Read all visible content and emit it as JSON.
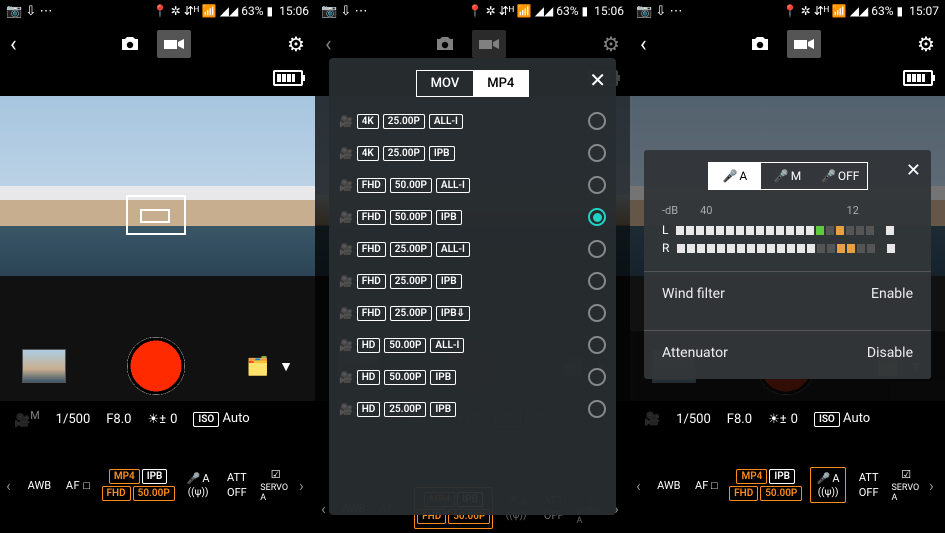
{
  "statusbar": {
    "left_icons": "📷  ⇩  ⋯",
    "right_icons": "📍 ✲ ⇵ᴴ 📶 ◢◢ 63% ▮",
    "time_a": "15:06",
    "time_b": "15:06",
    "time_c": "15:07",
    "battery_pct": "63%"
  },
  "info": {
    "camera_mode_label": "M",
    "shutter": "1/500",
    "aperture": "F8.0",
    "ev": "0",
    "iso_label": "ISO",
    "iso_value": "Auto"
  },
  "strip": {
    "awb": "AWB",
    "af": "AF □",
    "mp4": "MP4",
    "ipb": "IPB",
    "fhd": "FHD",
    "fps": "50.00P",
    "mic_mode": "A",
    "wind": "((ψ))",
    "att": "ATT",
    "att_state": "OFF",
    "servo": "SERVO A",
    "check": "☑"
  },
  "format_overlay": {
    "tabs": [
      "MOV",
      "MP4"
    ],
    "active_tab": 1,
    "options": [
      {
        "res": "4K",
        "fps": "25.00P",
        "codec": "ALL-I",
        "selected": false
      },
      {
        "res": "4K",
        "fps": "25.00P",
        "codec": "IPB",
        "selected": false
      },
      {
        "res": "FHD",
        "fps": "50.00P",
        "codec": "ALL-I",
        "selected": false
      },
      {
        "res": "FHD",
        "fps": "50.00P",
        "codec": "IPB",
        "selected": true
      },
      {
        "res": "FHD",
        "fps": "25.00P",
        "codec": "ALL-I",
        "selected": false
      },
      {
        "res": "FHD",
        "fps": "25.00P",
        "codec": "IPB",
        "selected": false
      },
      {
        "res": "FHD",
        "fps": "25.00P",
        "codec": "IPB⇩",
        "selected": false
      },
      {
        "res": "HD",
        "fps": "50.00P",
        "codec": "ALL-I",
        "selected": false
      },
      {
        "res": "HD",
        "fps": "50.00P",
        "codec": "IPB",
        "selected": false
      },
      {
        "res": "HD",
        "fps": "25.00P",
        "codec": "IPB",
        "selected": false
      }
    ]
  },
  "audio_overlay": {
    "modes": [
      "A",
      "M",
      "OFF"
    ],
    "active_mode": 0,
    "db_label": "-dB",
    "db_marks": {
      "a": "40",
      "b": "12"
    },
    "channels": [
      "L",
      "R"
    ],
    "wind_label": "Wind filter",
    "wind_value": "Enable",
    "att_label": "Attenuator",
    "att_value": "Disable"
  }
}
